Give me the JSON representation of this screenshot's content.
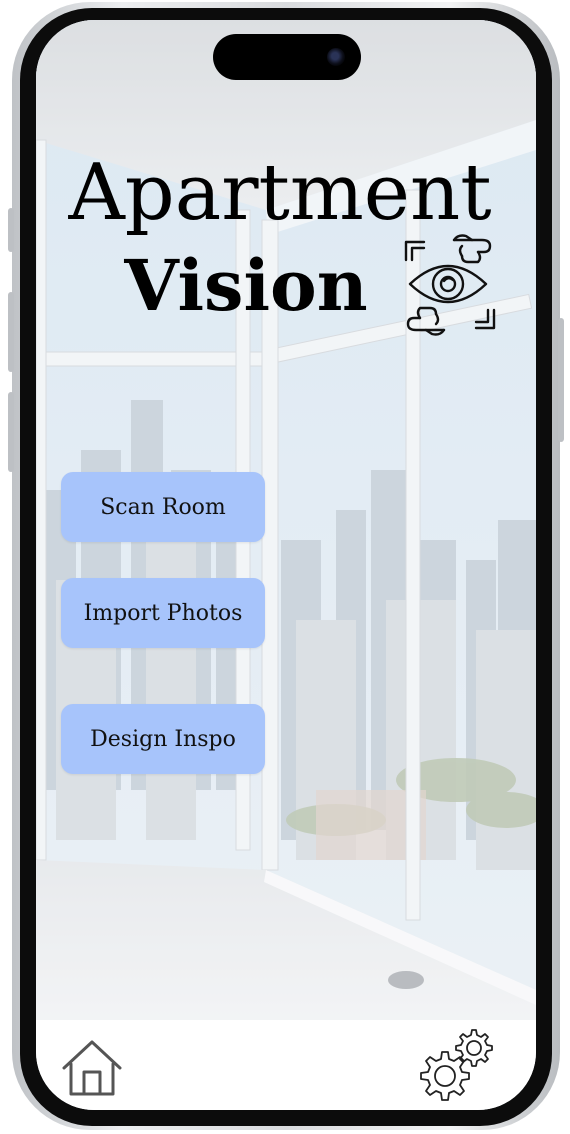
{
  "app": {
    "title_line1": "Apartment",
    "title_line2": "Vision",
    "logo_icon": "eye-scan-icon"
  },
  "actions": [
    {
      "label": "Scan Room"
    },
    {
      "label": "Import Photos"
    },
    {
      "label": "Design Inspo"
    }
  ],
  "bottom_nav": {
    "home_icon": "home-icon",
    "settings_icon": "settings-gears-icon"
  },
  "colors": {
    "button_fill": "#a7c4fb",
    "nav_background": "#ffffff",
    "title_text": "#000000"
  }
}
